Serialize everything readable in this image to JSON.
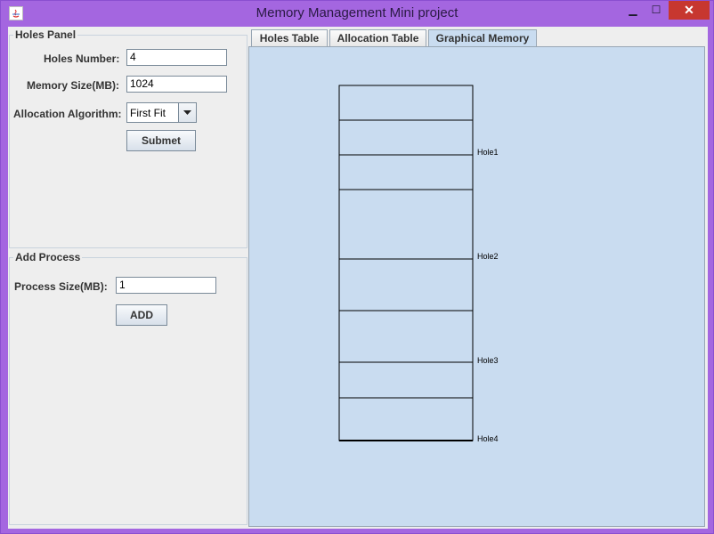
{
  "window": {
    "title": "Memory Management Mini project",
    "icon": "java-icon",
    "controls": {
      "minimize": "▁",
      "maximize": "☐",
      "close": "✕"
    }
  },
  "holes_panel": {
    "title": "Holes Panel",
    "holes_number_label": "Holes Number:",
    "holes_number_value": "4",
    "memory_size_label": "Memory Size(MB):",
    "memory_size_value": "1024",
    "algorithm_label": "Allocation Algorithm:",
    "algorithm_selected": "First Fit",
    "submit_label": "Submet"
  },
  "add_process": {
    "title": "Add Process",
    "process_size_label": "Process Size(MB):",
    "process_size_value": "1",
    "add_label": "ADD"
  },
  "tabs": [
    {
      "label": "Holes Table",
      "active": false
    },
    {
      "label": "Allocation Table",
      "active": false
    },
    {
      "label": "Graphical Memory",
      "active": true
    }
  ],
  "graphical_memory": {
    "holes": [
      "Hole1",
      "Hole2",
      "Hole3",
      "Hole4"
    ]
  },
  "colors": {
    "titlebar": "#a466e0",
    "panel_bg": "#eeeeee",
    "active_tab": "#c9dcf0",
    "close_button": "#c7372f",
    "annotation_underline": "#1a37c8"
  }
}
